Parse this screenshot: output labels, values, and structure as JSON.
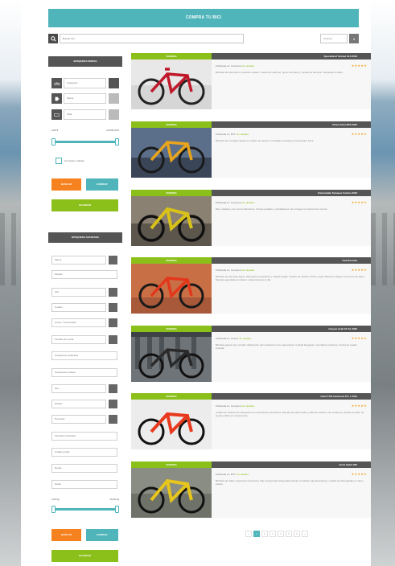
{
  "header": {
    "title": "COMPRA TU BICI"
  },
  "search": {
    "placeholder": "Buscar bici",
    "sort_value": "Ordenar"
  },
  "simple": {
    "title": "BÚSQUEDA SIMPLE",
    "fields": [
      "Categoría",
      "Marca",
      "Talla"
    ],
    "price_min": "0,00 €",
    "price_max": "10.000,00 €",
    "checkbox_label": "Con fotos / ofertas",
    "search_label": "BUSCAR",
    "reset_label": "BORRAR",
    "save_label": "GUARDAR"
  },
  "advanced": {
    "title": "BÚSQUEDA AVANZADA",
    "fields": [
      "Marca",
      "Modelo",
      "Año",
      "Cuadro",
      "Grupo / Transmisión",
      "Tamaño de rueda",
      "Suspensión delantera",
      "Suspensión trasera",
      "Uso",
      "Estado",
      "Provincia",
      "Vendedor particular",
      "Código postal",
      "Desde",
      "Hasta"
    ],
    "weight_min": "0,00 kg",
    "weight_max": "20,00 kg",
    "search_label": "BUSCAR",
    "reset_label": "BORRAR",
    "save_label": "GUARDAR"
  },
  "listings": [
    {
      "badge": "VENDIDA",
      "title": "Specialized Tarmac SL6 2019",
      "meta": "Publicada en: Carretera",
      "meta_accent": "Ver detalles",
      "stars": "★★★★★",
      "desc": "Bicicleta de carretera en perfecto estado. Cuadro de carbono, grupo completo y ruedas de aluminio. Revisada en taller."
    },
    {
      "badge": "VENDIDA",
      "title": "Orbea Alma M20 2020",
      "meta": "Publicada en: BTT",
      "meta_accent": "Ver detalles",
      "stars": "★★★★★",
      "desc": "Bicicleta de montaña rígida con cuadro de carbono, horquilla neumática y transmisión 1x12."
    },
    {
      "badge": "VENDIDA",
      "title": "Cannondale Synapse Carbon 2018",
      "meta": "Publicada en: Carretera",
      "meta_accent": "Ver detalles",
      "stars": "★★★★★",
      "desc": "Muy cuidada y con pocos kilómetros. Incluye pedales y portabidones. Se entrega con factura de compra."
    },
    {
      "badge": "VENDIDA",
      "title": "Trek Émonda",
      "meta": "Publicada en: Carretera",
      "meta_accent": "Ver detalles",
      "stars": "★★★★★",
      "desc": "Bicicleta de carretera ligera, ideal para competición y salidas largas. Cuadro de carbono OCLV, grupo Shimano Ultegra con frenos de disco. Siempre guardada en interior, mantenimiento al día."
    },
    {
      "badge": "VENDIDA",
      "title": "Canyon Grail CF SL 2020",
      "meta": "Publicada en: Gravel",
      "meta_accent": "Ver detalles",
      "stars": "★★★★★",
      "desc": "Bicicleta gravel muy versátil, válida tanto para carretera como para pistas. Cockpit integrado, neumáticos tubeless y bolsa de cuadro incluida."
    },
    {
      "badge": "VENDIDA",
      "title": "Giant TCR Advanced Pro 1 2019",
      "meta": "Publicada en: Carretera",
      "meta_accent": "Ver detalles",
      "stars": "★★★★★",
      "desc": "Cuadro de carbono de alta gama con transmisión electrónica. Ruedas de perfil medio y sillín de carbono. Se vende por cambio de talla. Se puede probar sin compromiso."
    },
    {
      "badge": "VENDIDA",
      "title": "Scott Spark 930",
      "meta": "Publicada en: BTT",
      "meta_accent": "Ver detalles",
      "stars": "★★★★★",
      "desc": "Bicicleta de doble suspensión para trail y rally. Suspensión bloqueable desde el manillar, tija telescópica y ruedas de 29 pulgadas en buen estado."
    }
  ],
  "pagination": {
    "prev": "«",
    "pages": [
      "1",
      "2",
      "3",
      "4",
      "5",
      "6"
    ],
    "next": "»"
  },
  "colors": {
    "brand_teal": "#4fb5ba",
    "accent_green": "#8bbf1a",
    "accent_orange": "#f5821f",
    "dark": "#555555"
  }
}
